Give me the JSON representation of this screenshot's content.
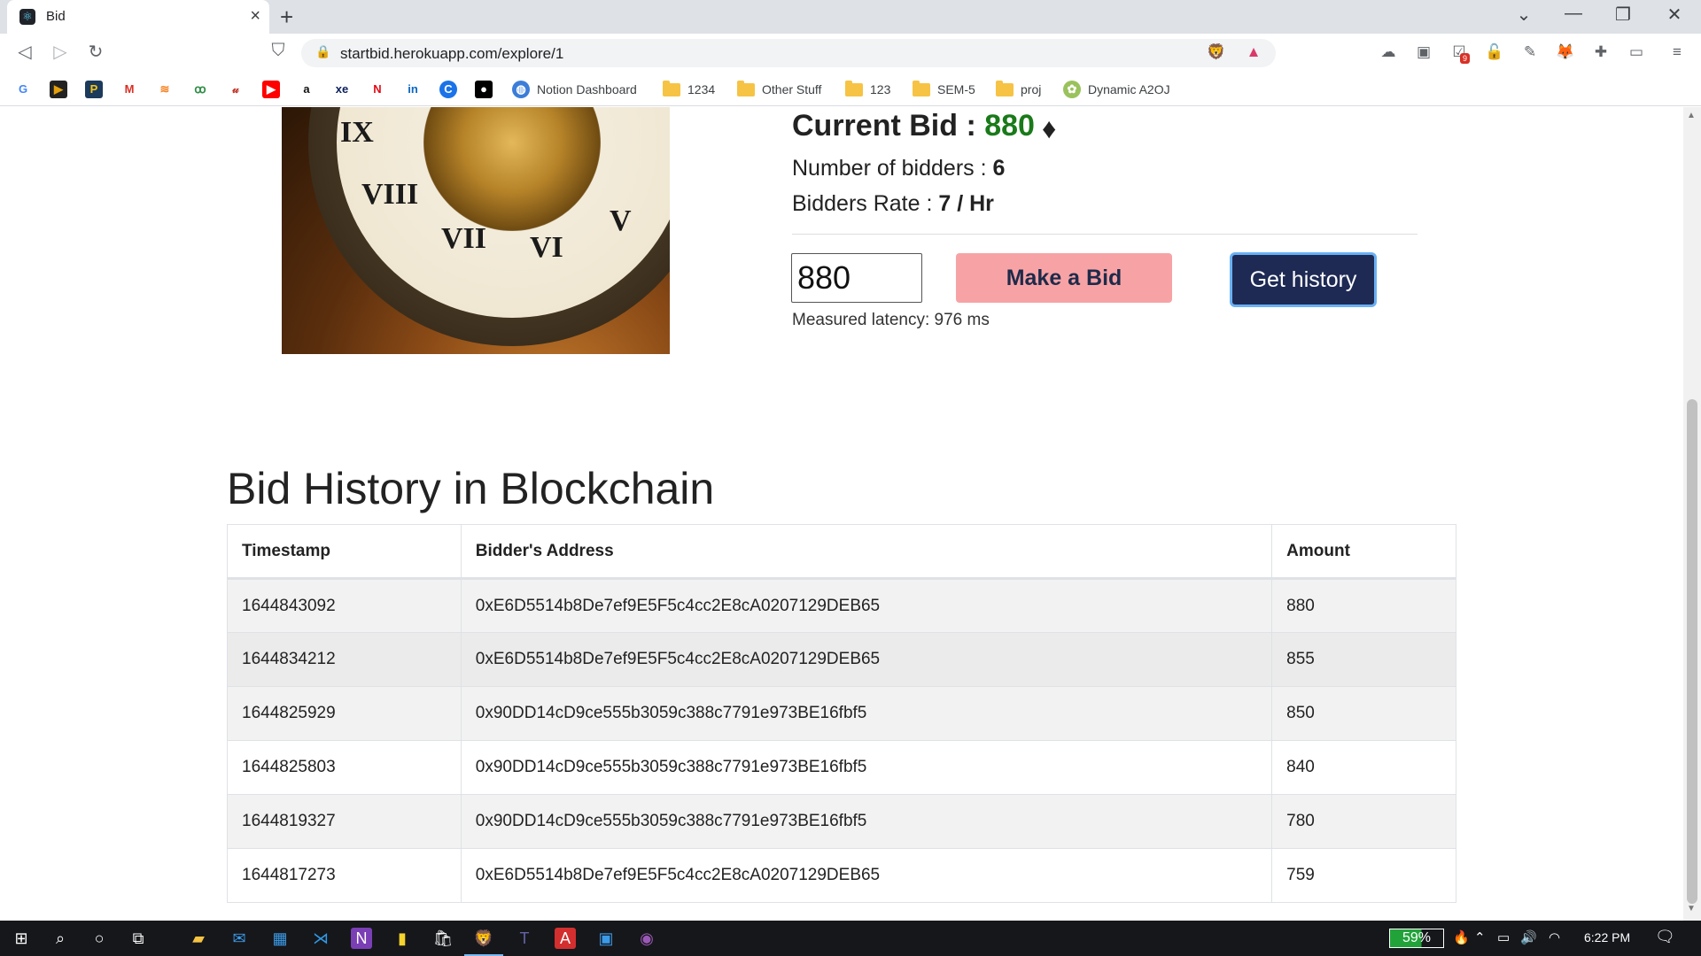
{
  "browser": {
    "tab_title": "Bid",
    "url": "startbid.herokuapp.com/explore/1",
    "extension_badge": "9",
    "bookmarks": [
      "Notion Dashboard",
      "1234",
      "Other Stuff",
      "123",
      "SEM-5",
      "proj",
      "Dynamic A2OJ"
    ]
  },
  "auction": {
    "current_bid_label": "Current Bid : ",
    "current_bid_value": "880",
    "bidders_label": "Number of bidders : ",
    "bidders_value": "6",
    "rate_label": "Bidders Rate : ",
    "rate_value": "7 / Hr",
    "bid_input_value": "880",
    "make_bid_label": "Make a Bid",
    "get_history_label": "Get history",
    "latency_text": "Measured latency: 976 ms"
  },
  "history": {
    "title": "Bid History in Blockchain",
    "columns": [
      "Timestamp",
      "Bidder's Address",
      "Amount"
    ],
    "rows": [
      {
        "timestamp": "1644843092",
        "address": "0xE6D5514b8De7ef9E5F5c4cc2E8cA0207129DEB65",
        "amount": "880"
      },
      {
        "timestamp": "1644834212",
        "address": "0xE6D5514b8De7ef9E5F5c4cc2E8cA0207129DEB65",
        "amount": "855"
      },
      {
        "timestamp": "1644825929",
        "address": "0x90DD14cD9ce555b3059c388c7791e973BE16fbf5",
        "amount": "850"
      },
      {
        "timestamp": "1644825803",
        "address": "0x90DD14cD9ce555b3059c388c7791e973BE16fbf5",
        "amount": "840"
      },
      {
        "timestamp": "1644819327",
        "address": "0x90DD14cD9ce555b3059c388c7791e973BE16fbf5",
        "amount": "780"
      },
      {
        "timestamp": "1644817273",
        "address": "0xE6D5514b8De7ef9E5F5c4cc2E8cA0207129DEB65",
        "amount": "759"
      }
    ]
  },
  "taskbar": {
    "battery": "59%",
    "clock": "6:22 PM"
  },
  "colors": {
    "bid_value": "#1a7a1a",
    "make_bid_bg": "#f7a3a6",
    "get_history_bg": "#1e2a54"
  }
}
